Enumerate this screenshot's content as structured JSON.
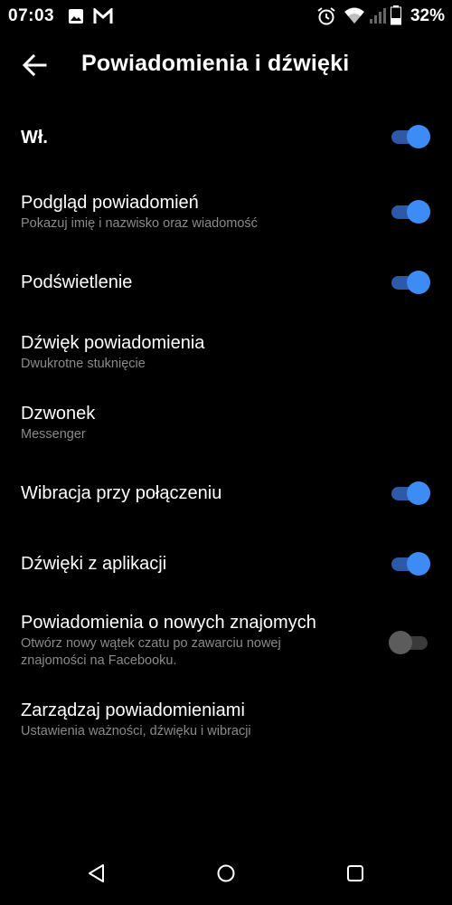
{
  "status_bar": {
    "time": "07:03",
    "left_icons": [
      "image-icon",
      "gmail-icon"
    ],
    "right_icons": [
      "alarm-icon",
      "wifi-icon",
      "signal-icon",
      "battery-icon"
    ],
    "battery_percent": "32%"
  },
  "app_bar": {
    "back_icon": "arrow-back-icon",
    "title": "Powiadomienia i dźwięki"
  },
  "settings": [
    {
      "title": "Wł.",
      "subtitle": "",
      "toggle": true
    },
    {
      "title": "Podgląd powiadomień",
      "subtitle": "Pokazuj imię i nazwisko oraz wiadomość",
      "toggle": true
    },
    {
      "title": "Podświetlenie",
      "subtitle": "",
      "toggle": true
    },
    {
      "title": "Dźwięk powiadomienia",
      "subtitle": "Dwukrotne stuknięcie",
      "toggle": null
    },
    {
      "title": "Dzwonek",
      "subtitle": "Messenger",
      "toggle": null
    },
    {
      "title": "Wibracja przy połączeniu",
      "subtitle": "",
      "toggle": true
    },
    {
      "title": "Dźwięki z aplikacji",
      "subtitle": "",
      "toggle": true
    },
    {
      "title": "Powiadomienia o nowych znajomych",
      "subtitle": "Otwórz nowy wątek czatu po zawarciu nowej znajomości na Facebooku.",
      "toggle": false
    },
    {
      "title": "Zarządzaj powiadomieniami",
      "subtitle": "Ustawienia ważności, dźwięku i wibracji",
      "toggle": null
    }
  ],
  "nav_bar": {
    "buttons": [
      "back-triangle-icon",
      "home-circle-icon",
      "recents-square-icon"
    ]
  },
  "colors": {
    "background": "#000000",
    "toggle_on_thumb": "#3d8bf5",
    "toggle_on_track": "#2c5aa8",
    "toggle_off_thumb": "#5c5c5c",
    "subtitle": "#8a8a8a"
  }
}
